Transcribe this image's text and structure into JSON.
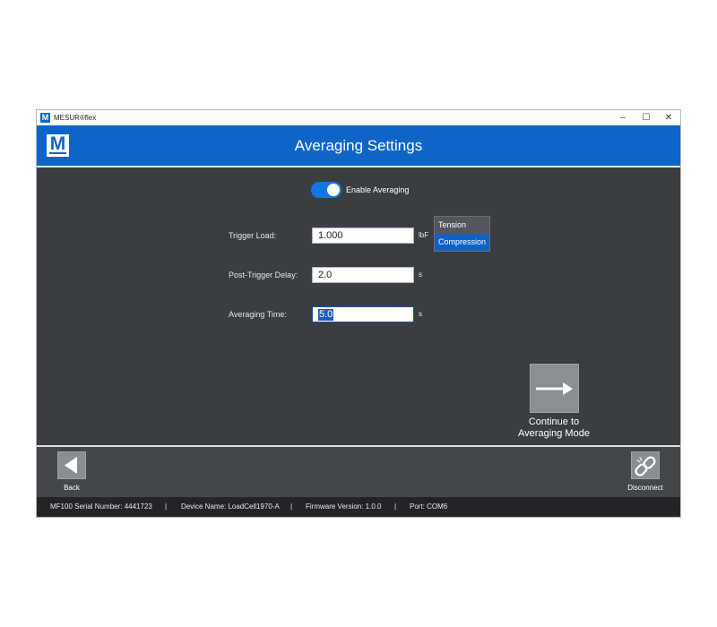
{
  "window": {
    "title": "MESUR®flex",
    "app_icon_letter": "M",
    "controls": {
      "minimize": "–",
      "maximize": "☐",
      "close": "✕"
    }
  },
  "header": {
    "logo_letter": "M",
    "title": "Averaging Settings"
  },
  "averaging": {
    "toggle_label": "Enable Averaging",
    "enabled": true
  },
  "fields": {
    "trigger_load": {
      "label": "Trigger Load:",
      "value": "1.000",
      "unit": "lbF"
    },
    "post_trigger_delay": {
      "label": "Post-Trigger Delay:",
      "value": "2.0",
      "unit": "s"
    },
    "averaging_time": {
      "label": "Averaging Time:",
      "value": "5.0",
      "unit": "s"
    }
  },
  "direction": {
    "options": [
      "Tension",
      "Compression"
    ],
    "selected": "Compression"
  },
  "continue": {
    "label_line1": "Continue to",
    "label_line2": "Averaging Mode",
    "icon": "arrow-right-icon"
  },
  "footer": {
    "back_label": "Back",
    "back_icon": "triangle-left-icon",
    "disconnect_label": "Disconnect",
    "disconnect_icon": "broken-link-icon"
  },
  "status": {
    "serial": "MF100 Serial Number: 4441723",
    "device": "Device Name: LoadCell1970-A",
    "firmware": "Firmware Version: 1.0.0",
    "port": "Port: COM6",
    "separator": "|"
  },
  "colors": {
    "header_blue": "#0d66c6",
    "panel": "#3a3d42",
    "accent": "#1476e0",
    "status_bar": "#222427"
  }
}
